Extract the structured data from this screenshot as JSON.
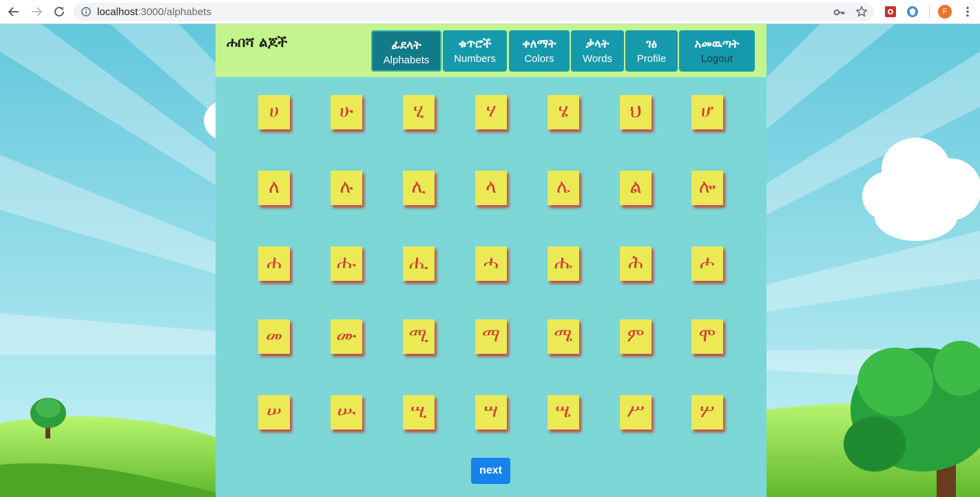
{
  "browser": {
    "url_host": "localhost",
    "url_path": ":3000/alphabets",
    "profile_initial": "F"
  },
  "app": {
    "brand": "ሐበሻ ልጆች",
    "colors": {
      "topbar": "#c4f48d",
      "panel": "#7dd7d7",
      "tab": "#1599ac",
      "tab_active": "#137a87",
      "card": "#ebea55",
      "letter": "#d43e35",
      "next_button": "#1582ed"
    },
    "nav": [
      {
        "am": "ፊደላት",
        "en": "Alphabets",
        "active": true
      },
      {
        "am": "ቁጥሮች",
        "en": "Numbers"
      },
      {
        "am": "ቀለማት",
        "en": "Colors"
      },
      {
        "am": "ቃላት",
        "en": "Words"
      },
      {
        "am": "ገፅ",
        "en": "Profile"
      },
      {
        "am": "አመዉጣት",
        "en": "Logout"
      }
    ],
    "letters": [
      [
        "ሀ",
        "ሁ",
        "ሂ",
        "ሃ",
        "ሄ",
        "ህ",
        "ሆ"
      ],
      [
        "ለ",
        "ሉ",
        "ሊ",
        "ላ",
        "ሌ",
        "ል",
        "ሎ"
      ],
      [
        "ሐ",
        "ሑ",
        "ሒ",
        "ሓ",
        "ሔ",
        "ሕ",
        "ሖ"
      ],
      [
        "መ",
        "ሙ",
        "ሚ",
        "ማ",
        "ሜ",
        "ም",
        "ሞ"
      ],
      [
        "ሠ",
        "ሡ",
        "ሢ",
        "ሣ",
        "ሤ",
        "ሥ",
        "ሦ"
      ]
    ],
    "next_label": "next"
  }
}
